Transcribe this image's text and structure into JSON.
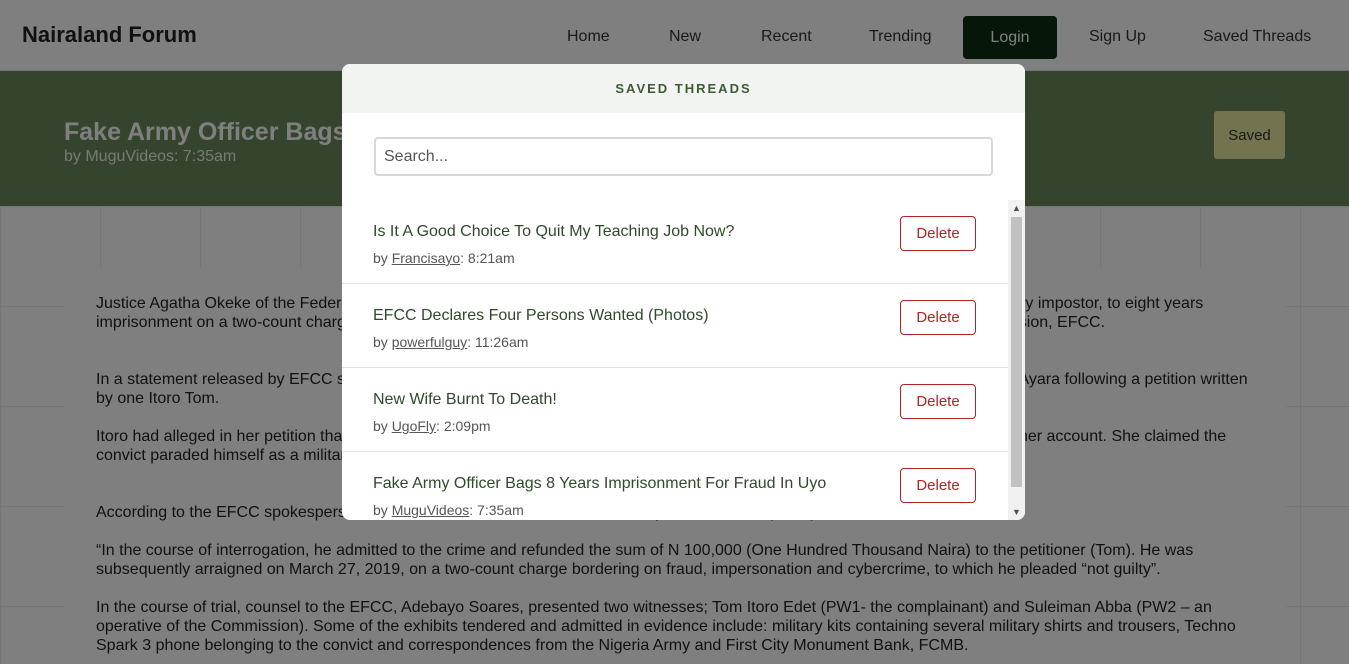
{
  "app": {
    "logo": "Nairaland Forum"
  },
  "nav": [
    {
      "label": "Home"
    },
    {
      "label": "New"
    },
    {
      "label": "Recent"
    },
    {
      "label": "Trending"
    },
    {
      "label": "Login"
    },
    {
      "label": "Sign Up"
    },
    {
      "label": "Saved Threads"
    }
  ],
  "thread": {
    "title": "Fake Army Officer Bags 8 Years Imprisonment For Fraud In Uyo",
    "meta": "by MuguVideos: 7:35am",
    "saved_label": "Saved"
  },
  "article": {
    "paragraphs": [
      "Justice Agatha Okeke of the Federal High Court sitting in Uyo, Akwa Ibom State has convicted and sentenced one Asuquo, a military impostor, to eight years imprisonment on a two-count charge preferred against him by the Uyo Zonal Office of the Economic and Financial Crimes Commission, EFCC.",
      "In a statement released by EFCC spokesperson, the convict met his Waterloo when operatives of the Commission arrested him at Ayara following a petition written by one Itoro Tom.",
      "Itoro had alleged in her petition that the convict fraudulently obtained the sum of N700,000 (Seven Hundred Thousand Naira) from her account. She claimed the convict paraded himself as a military officer and in that capacity deceived her into parting with the money.",
      "According to the EFCC spokesperson, items recovered from him include military kits, and bulletproof jackets.",
      "“In the course of interrogation, he admitted to the crime and refunded the sum of N 100,000 (One Hundred Thousand Naira) to the petitioner (Tom). He was subsequently arraigned on March 27, 2019, on a two-count charge bordering on fraud, impersonation and cybercrime, to which he pleaded “not guilty”.",
      "In the course of trial, counsel to the EFCC, Adebayo Soares, presented two witnesses; Tom Itoro Edet (PW1- the complainant) and Suleiman Abba (PW2 – an operative of the Commission). Some of the exhibits tendered and admitted in evidence include: military kits containing several military shirts and trousers, Techno Spark 3 phone belonging to the convict and correspondences from the Nigeria Army and First City Monument Bank, FCMB."
    ]
  },
  "modal": {
    "title": "SAVED THREADS",
    "search_placeholder": "Search...",
    "delete_label": "Delete",
    "items": [
      {
        "title": "Is It A Good Choice To Quit My Teaching Job Now?",
        "author": "Francisayo",
        "time": ": 8:21am"
      },
      {
        "title": "EFCC Declares Four Persons Wanted (Photos)",
        "author": "powerfulguy",
        "time": ": 11:26am"
      },
      {
        "title": "New Wife Burnt To Death!",
        "author": "UgoFly",
        "time": ": 2:09pm"
      },
      {
        "title": "Fake Army Officer Bags 8 Years Imprisonment For Fraud In Uyo",
        "author": "MuguVideos",
        "time": ": 7:35am"
      }
    ],
    "by_prefix": "by "
  },
  "colors": {
    "accent": "#3f5a35",
    "header_bg": "#6b8a5a",
    "danger": "#b22222",
    "login_bg": "#0d2d10"
  },
  "icons": {
    "scroll_up": "scroll-up-arrow-icon",
    "scroll_down": "scroll-down-arrow-icon"
  }
}
